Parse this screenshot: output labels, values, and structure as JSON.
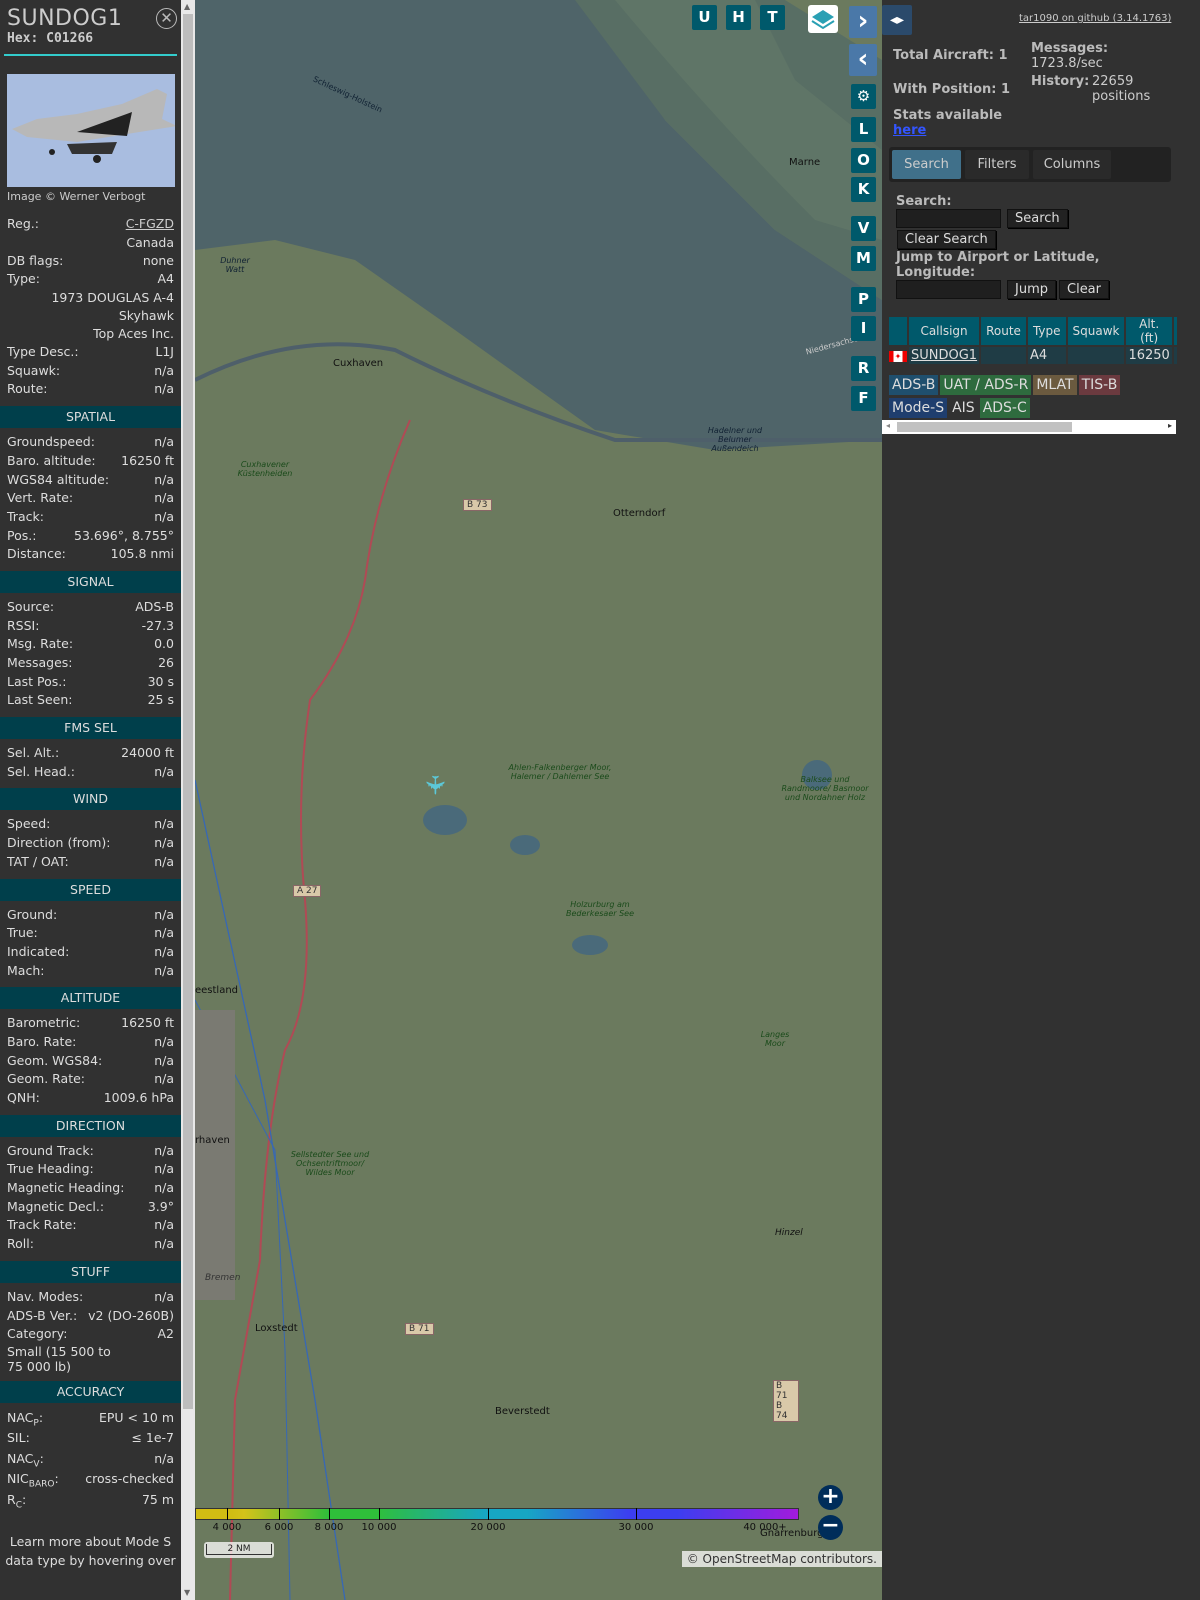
{
  "aircraft": {
    "callsign": "SUNDOG1",
    "hex": "Hex: C01266",
    "image_credit": "Image © Werner Verbogt"
  },
  "info": [
    {
      "label": "Reg.:",
      "value": "C-FGZD",
      "link": true
    },
    {
      "label": "",
      "value": "Canada"
    },
    {
      "label": "DB flags:",
      "value": "none"
    },
    {
      "label": "Type:",
      "value": "A4"
    },
    {
      "label": "",
      "value": "1973 DOUGLAS A-4 Skyhawk"
    },
    {
      "label": "",
      "value": "Top Aces Inc."
    },
    {
      "label": "Type Desc.:",
      "value": "L1J"
    },
    {
      "label": "Squawk:",
      "value": "n/a"
    },
    {
      "label": "Route:",
      "value": "n/a"
    }
  ],
  "sections": [
    {
      "title": "SPATIAL",
      "rows": [
        [
          "Groundspeed:",
          "n/a"
        ],
        [
          "Baro. altitude:",
          "16250 ft"
        ],
        [
          "WGS84 altitude:",
          "n/a"
        ],
        [
          "Vert. Rate:",
          "n/a"
        ],
        [
          "Track:",
          "n/a"
        ],
        [
          "Pos.:",
          "53.696°, 8.755°"
        ],
        [
          "Distance:",
          "105.8 nmi"
        ]
      ]
    },
    {
      "title": "SIGNAL",
      "rows": [
        [
          "Source:",
          "ADS-B"
        ],
        [
          "RSSI:",
          "-27.3"
        ],
        [
          "Msg. Rate:",
          "0.0"
        ],
        [
          "Messages:",
          "26"
        ],
        [
          "Last Pos.:",
          "30 s"
        ],
        [
          "Last Seen:",
          "25 s"
        ]
      ]
    },
    {
      "title": "FMS SEL",
      "rows": [
        [
          "Sel. Alt.:",
          "24000 ft"
        ],
        [
          "Sel. Head.:",
          "n/a"
        ]
      ]
    },
    {
      "title": "WIND",
      "rows": [
        [
          "Speed:",
          "n/a"
        ],
        [
          "Direction (from):",
          "n/a"
        ],
        [
          "TAT / OAT:",
          "n/a"
        ]
      ]
    },
    {
      "title": "SPEED",
      "rows": [
        [
          "Ground:",
          "n/a"
        ],
        [
          "True:",
          "n/a"
        ],
        [
          "Indicated:",
          "n/a"
        ],
        [
          "Mach:",
          "n/a"
        ]
      ]
    },
    {
      "title": "ALTITUDE",
      "rows": [
        [
          "Barometric:",
          "16250 ft"
        ],
        [
          "Baro. Rate:",
          "n/a"
        ],
        [
          "Geom. WGS84:",
          "n/a"
        ],
        [
          "Geom. Rate:",
          "n/a"
        ],
        [
          "QNH:",
          "1009.6 hPa"
        ]
      ]
    },
    {
      "title": "DIRECTION",
      "rows": [
        [
          "Ground Track:",
          "n/a"
        ],
        [
          "True Heading:",
          "n/a"
        ],
        [
          "Magnetic Heading:",
          "n/a"
        ],
        [
          "Magnetic Decl.:",
          "3.9°"
        ],
        [
          "Track Rate:",
          "n/a"
        ],
        [
          "Roll:",
          "n/a"
        ]
      ]
    },
    {
      "title": "STUFF",
      "rows": [
        [
          "Nav. Modes:",
          "n/a"
        ],
        [
          "ADS-B Ver.:",
          "v2 (DO-260B)"
        ],
        [
          "Category:",
          "A2"
        ]
      ],
      "extra": "Small (15 500 to 75 000 lb)"
    }
  ],
  "accuracy": {
    "title": "ACCURACY",
    "rows": [
      {
        "base": "NAC",
        "sub": "P",
        "value": "EPU < 10 m"
      },
      {
        "base": "SIL",
        "sub": "",
        "value": "≤ 1e-7"
      },
      {
        "base": "NAC",
        "sub": "V",
        "value": "n/a"
      },
      {
        "base": "NIC",
        "sub": "BARO",
        "value": "cross-checked"
      },
      {
        "base": "R",
        "sub": "C",
        "value": "75 m"
      }
    ],
    "footer": "Learn more about Mode S data type by hovering over"
  },
  "map": {
    "top_buttons": [
      "U",
      "H",
      "T"
    ],
    "side_buttons": [
      "L",
      "O",
      "K",
      "V",
      "M",
      "P",
      "I",
      "R",
      "F"
    ],
    "places": [
      "Cuxhaven",
      "Otterndorf",
      "Marne",
      "Beverstedt",
      "Loxstedt",
      "Hinzel",
      "Bremen",
      "Cuxhavener Küstenheiden",
      "Duhner Watt",
      "Hadelner und Belumer Außendeich",
      "Ahlen-Falkenberger Moor, Halemer / Dahlemer See",
      "Holzurburg am Bederkesaer See",
      "Balksee und Randmoore/ Basmoor und Nordahner Holz",
      "Sellstedter See und Ochsentriftmoor/ Wildes Moor",
      "Langes Moor",
      "Niedersachsen",
      "Schleswig-Holstein",
      "eestland",
      "rhaven",
      "Gnarrenburg"
    ],
    "roads": [
      "B 73",
      "A 27",
      "B 71",
      "B 71 B 74"
    ],
    "altitude_legend": [
      "4 000",
      "6 000",
      "8 000",
      "10 000",
      "20 000",
      "30 000",
      "40 000+"
    ],
    "scale": "2 NM",
    "attribution": "© OpenStreetMap contributors."
  },
  "right": {
    "github": "tar1090 on github (3.14.1763)",
    "total_aircraft": "Total Aircraft: 1",
    "with_position": "With Position: 1",
    "messages_label": "Messages:",
    "messages": "1723.8/sec",
    "history_label": "History:",
    "history": "22659 positions",
    "stats": "Stats available",
    "here": "here",
    "tabs": [
      "Search",
      "Filters",
      "Columns"
    ],
    "search_label": "Search:",
    "search_btn": "Search",
    "clear_search": "Clear Search",
    "jump_label": "Jump to Airport or Latitude, Longitude:",
    "jump_btn": "Jump",
    "clear_btn": "Clear",
    "columns": [
      "",
      "Callsign",
      "Route",
      "Type",
      "Squawk",
      "Alt. (ft)",
      "Sp"
    ],
    "rows": [
      {
        "callsign": "SUNDOG1",
        "route": "",
        "type": "A4",
        "squawk": "",
        "alt": "16250"
      }
    ],
    "sources": [
      {
        "name": "ADS-B",
        "color": "#1f4f6e"
      },
      {
        "name": "UAT / ADS-R",
        "color": "#2e6b3e"
      },
      {
        "name": "MLAT",
        "color": "#6b5a3f"
      },
      {
        "name": "TIS-B",
        "color": "#6b3a3f"
      },
      {
        "name": "Mode-S",
        "color": "#1f3e6e"
      },
      {
        "name": "AIS",
        "color": "#313131"
      },
      {
        "name": "ADS-C",
        "color": "#2e6b3e"
      }
    ]
  }
}
